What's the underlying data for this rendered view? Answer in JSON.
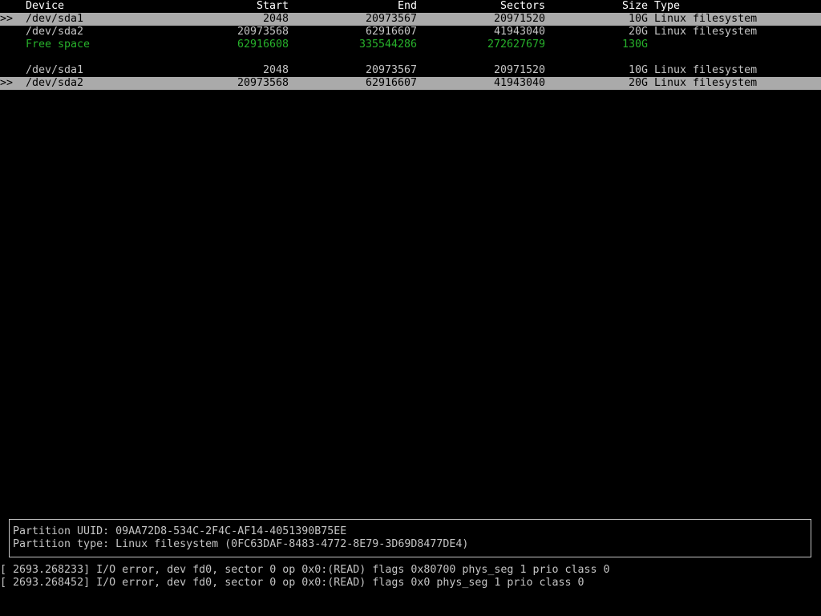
{
  "table": {
    "headers": {
      "device": "Device",
      "start": "Start",
      "end": "End",
      "sectors": "Sectors",
      "size": "Size",
      "type": "Type"
    },
    "rows_top": [
      {
        "marker": ">>",
        "device": "/dev/sda1",
        "start": "2048",
        "end": "20973567",
        "sectors": "20971520",
        "size": "10G",
        "type": "Linux filesystem",
        "selected": true
      },
      {
        "marker": "",
        "device": "/dev/sda2",
        "start": "20973568",
        "end": "62916607",
        "sectors": "41943040",
        "size": "20G",
        "type": "Linux filesystem",
        "selected": false
      },
      {
        "marker": "",
        "device": "Free space",
        "start": "62916608",
        "end": "335544286",
        "sectors": "272627679",
        "size": "130G",
        "type": "",
        "selected": false
      }
    ],
    "rows_bottom": [
      {
        "marker": "",
        "device": "/dev/sda1",
        "start": "2048",
        "end": "20973567",
        "sectors": "20971520",
        "size": "10G",
        "type": "Linux filesystem",
        "selected": false
      },
      {
        "marker": ">>",
        "device": "/dev/sda2",
        "start": "20973568",
        "end": "62916607",
        "sectors": "41943040",
        "size": "20G",
        "type": "Linux filesystem",
        "selected": true
      }
    ]
  },
  "info": {
    "uuid_line": "Partition UUID: 09AA72D8-534C-2F4C-AF14-4051390B75EE",
    "type_line": "Partition type: Linux filesystem (0FC63DAF-8483-4772-8E79-3D69D8477DE4)"
  },
  "log": {
    "line1": "[ 2693.268233] I/O error, dev fd0, sector 0 op 0x0:(READ) flags 0x80700 phys_seg 1 prio class 0",
    "line2": "[ 2693.268452] I/O error, dev fd0, sector 0 op 0x0:(READ) flags 0x0 phys_seg 1 prio class 0"
  },
  "colors": {
    "background": "#000000",
    "text": "#c4c4c4",
    "header": "#ffffff",
    "selection_bg": "#aaaaaa",
    "free_space": "#27b12b"
  }
}
